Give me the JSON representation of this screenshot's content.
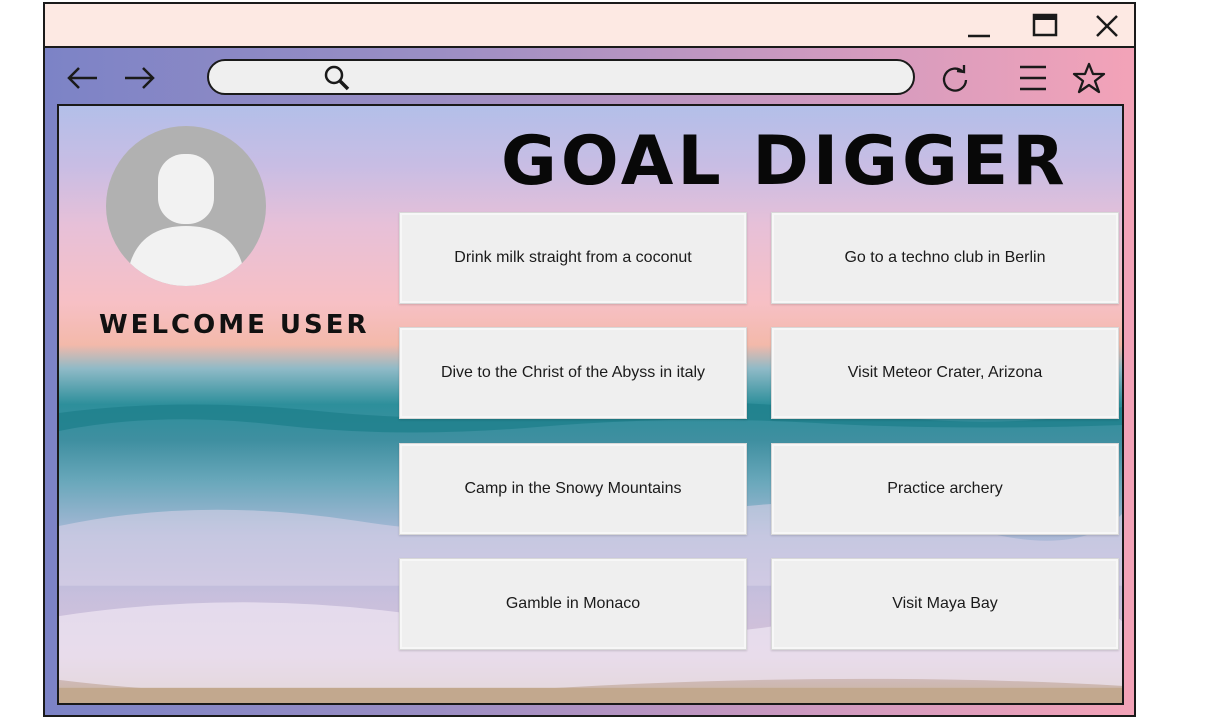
{
  "window": {
    "controls": {
      "minimize_icon": "minimize-icon",
      "maximize_icon": "maximize-icon",
      "close_icon": "close-icon"
    }
  },
  "navbar": {
    "icons": [
      "back-arrow-icon",
      "forward-arrow-icon",
      "search-icon",
      "refresh-icon",
      "menu-icon",
      "star-icon"
    ],
    "address_value": ""
  },
  "profile": {
    "welcome_text": "WELCOME USER"
  },
  "page": {
    "title": "GOAL DIGGER"
  },
  "goals": [
    "Drink milk straight from a coconut",
    "Go to a techno club in Berlin",
    "Dive to the Christ of the Abyss in italy",
    "Visit Meteor Crater, Arizona",
    "Camp in the Snowy Mountains",
    "Practice archery",
    "Gamble in Monaco",
    "Visit Maya Bay"
  ],
  "colors": {
    "titlebar": "#fde9e3",
    "toolbar_gradient_start": "#7c83c6",
    "toolbar_gradient_end": "#f3a3b8",
    "card": "#efefef",
    "avatar": "#b1b1b1"
  }
}
